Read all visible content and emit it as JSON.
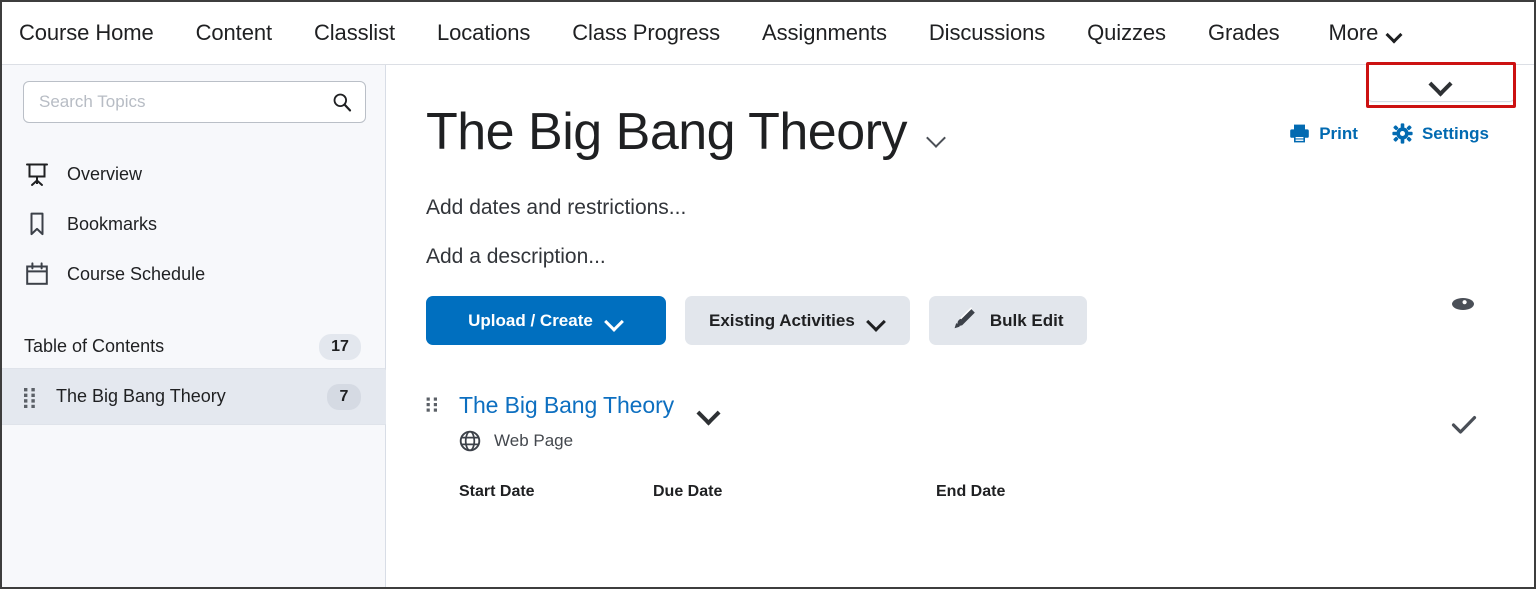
{
  "topnav": {
    "items": [
      {
        "label": "Course Home"
      },
      {
        "label": "Content"
      },
      {
        "label": "Classlist"
      },
      {
        "label": "Locations"
      },
      {
        "label": "Class Progress"
      },
      {
        "label": "Assignments"
      },
      {
        "label": "Discussions"
      },
      {
        "label": "Quizzes"
      },
      {
        "label": "Grades"
      },
      {
        "label": "More"
      }
    ]
  },
  "top_right_dropdown": {
    "label": "",
    "icon": "chevron-down-icon",
    "highlight_color": "#cc1111"
  },
  "sidebar": {
    "search": {
      "value": "",
      "placeholder": "Search Topics",
      "icon": "search-icon"
    },
    "items": [
      {
        "label": "Overview",
        "icon": "presentation-icon"
      },
      {
        "label": "Bookmarks",
        "icon": "bookmark-icon"
      },
      {
        "label": "Course Schedule",
        "icon": "calendar-icon"
      }
    ],
    "toc": {
      "label": "Table of Contents",
      "count": "17"
    },
    "modules": [
      {
        "label": "The Big Bang Theory",
        "count": "7",
        "selected": true,
        "drag_icon": "drag-handle-icon"
      }
    ]
  },
  "main": {
    "title": "The Big Bang Theory",
    "title_chevron_icon": "chevron-down-icon",
    "util_links": [
      {
        "label": "Print",
        "icon": "printer-icon"
      },
      {
        "label": "Settings",
        "icon": "gear-icon"
      }
    ],
    "accent_color": "#026ab1",
    "placeholders": {
      "dates": "Add dates and restrictions...",
      "description": "Add a description..."
    },
    "visibility_icon": "eye-icon",
    "buttons": [
      {
        "label": "Upload / Create",
        "style": "primary",
        "chevron": true
      },
      {
        "label": "Existing Activities",
        "style": "secondary",
        "chevron": true
      },
      {
        "label": "Bulk Edit",
        "style": "secondary",
        "icon": "pencil-icon"
      }
    ],
    "content_item": {
      "title": "The Big Bang Theory",
      "type_label": "Web Page",
      "type_icon": "globe-icon",
      "drag_icon": "drag-handle-icon",
      "chevron_icon": "chevron-down-icon",
      "status_icon": "check-icon"
    },
    "date_headers": {
      "start": "Start Date",
      "due": "Due Date",
      "end": "End Date"
    }
  }
}
